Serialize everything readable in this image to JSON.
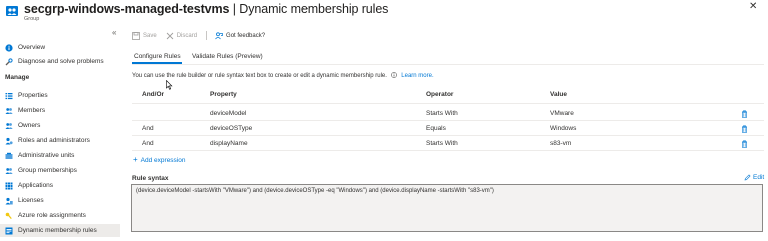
{
  "header": {
    "title_bold": "secgrp-windows-managed-testvms",
    "title_rest": " | Dynamic membership rules",
    "more": "···",
    "subtitle": "Group",
    "close": "✕"
  },
  "sidebar": {
    "collapse": "«",
    "items_top": [
      {
        "label": "Overview",
        "icon": "info-circle-icon"
      },
      {
        "label": "Diagnose and solve problems",
        "icon": "wrench-icon"
      }
    ],
    "section_manage": "Manage",
    "items_manage": [
      {
        "label": "Properties",
        "icon": "properties-icon"
      },
      {
        "label": "Members",
        "icon": "members-icon"
      },
      {
        "label": "Owners",
        "icon": "owners-icon"
      },
      {
        "label": "Roles and administrators",
        "icon": "roles-icon"
      },
      {
        "label": "Administrative units",
        "icon": "admin-units-icon"
      },
      {
        "label": "Group memberships",
        "icon": "group-memberships-icon"
      },
      {
        "label": "Applications",
        "icon": "applications-icon"
      },
      {
        "label": "Licenses",
        "icon": "licenses-icon"
      },
      {
        "label": "Azure role assignments",
        "icon": "key-icon"
      },
      {
        "label": "Dynamic membership rules",
        "icon": "dynamic-rules-icon",
        "active": true
      }
    ]
  },
  "toolbar": {
    "save": "Save",
    "discard": "Discard",
    "feedback": "Got feedback?"
  },
  "tabs": {
    "configure": "Configure Rules",
    "validate": "Validate Rules (Preview)"
  },
  "info": {
    "text": "You can use the rule builder or rule syntax text box to create or edit a dynamic membership rule.",
    "link": "Learn more."
  },
  "table": {
    "headers": {
      "andor": "And/Or",
      "property": "Property",
      "operator": "Operator",
      "value": "Value"
    },
    "rows": [
      {
        "andor": "",
        "property": "deviceModel",
        "operator": "Starts With",
        "value": "VMware"
      },
      {
        "andor": "And",
        "property": "deviceOSType",
        "operator": "Equals",
        "value": "Windows"
      },
      {
        "andor": "And",
        "property": "displayName",
        "operator": "Starts With",
        "value": "s83-vm"
      }
    ]
  },
  "add_expression": "Add expression",
  "rule_syntax": {
    "label": "Rule syntax",
    "edit": "Edit",
    "text": "(device.deviceModel -startsWith \"VMware\") and (device.deviceOSType -eq \"Windows\") and (device.displayName -startsWith \"s83-vm\")"
  },
  "colors": {
    "accent": "#0078d4",
    "active_nav": "#edebe9",
    "syntax_bg": "#f3f2f1"
  }
}
